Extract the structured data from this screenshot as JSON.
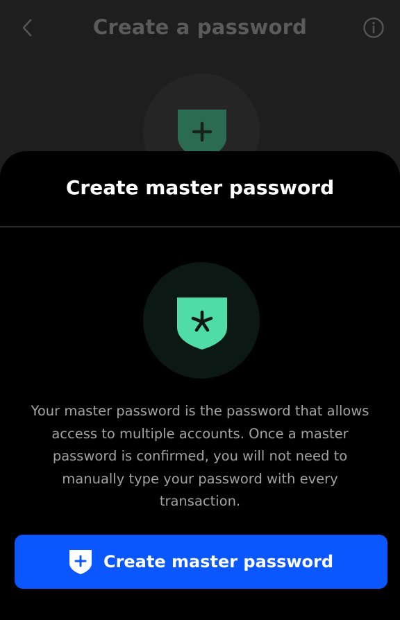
{
  "background_screen": {
    "title": "Create a password",
    "back_icon": "chevron-left-icon",
    "info_icon": "info-icon",
    "shield_icon": "shield-plus-icon"
  },
  "sheet": {
    "title": "Create master password",
    "icon": "shield-asterisk-icon",
    "description": "Your master password is the password that allows access to multiple accounts. Once a master password is confirmed, you will not need to manually type your password with every transaction.",
    "primary_button": {
      "label": "Create master password",
      "icon": "shield-plus-icon"
    }
  },
  "colors": {
    "accent": "#0a57ff",
    "shield_green": "#4fdca6",
    "shield_green_dim": "#2b6b53"
  }
}
